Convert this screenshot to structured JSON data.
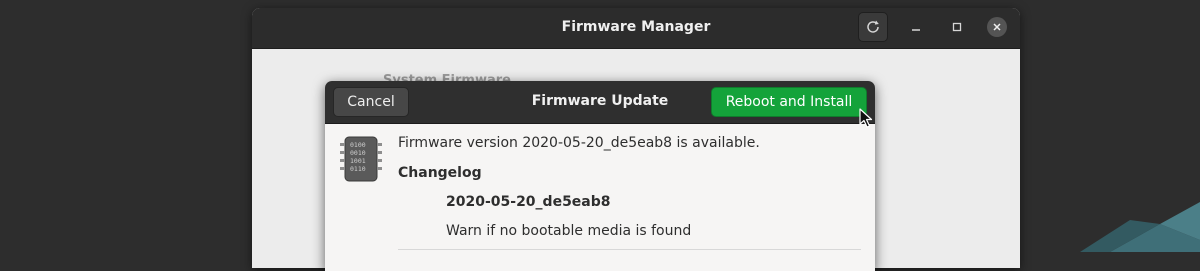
{
  "window": {
    "title": "Firmware Manager",
    "section_label": "System Firmware"
  },
  "dialog": {
    "title": "Firmware Update",
    "cancel_label": "Cancel",
    "primary_label": "Reboot and Install",
    "primary_color": "#14a33a",
    "available_text": "Firmware version 2020-05-20_de5eab8 is available.",
    "changelog_heading": "Changelog",
    "changelog": [
      {
        "version": "2020-05-20_de5eab8",
        "changes": [
          "Warn if no bootable media is found"
        ]
      }
    ]
  },
  "icons": {
    "refresh": "refresh-icon",
    "minimize": "minimize-icon",
    "maximize": "maximize-icon",
    "close": "close-icon",
    "firmware": "firmware-chip-icon",
    "cursor": "mouse-cursor-icon"
  },
  "colors": {
    "titlebar": "#2c2c2c",
    "accent_green": "#14a33a",
    "desktop": "#2d2d2d",
    "desktop_accent": "#3e6870"
  }
}
